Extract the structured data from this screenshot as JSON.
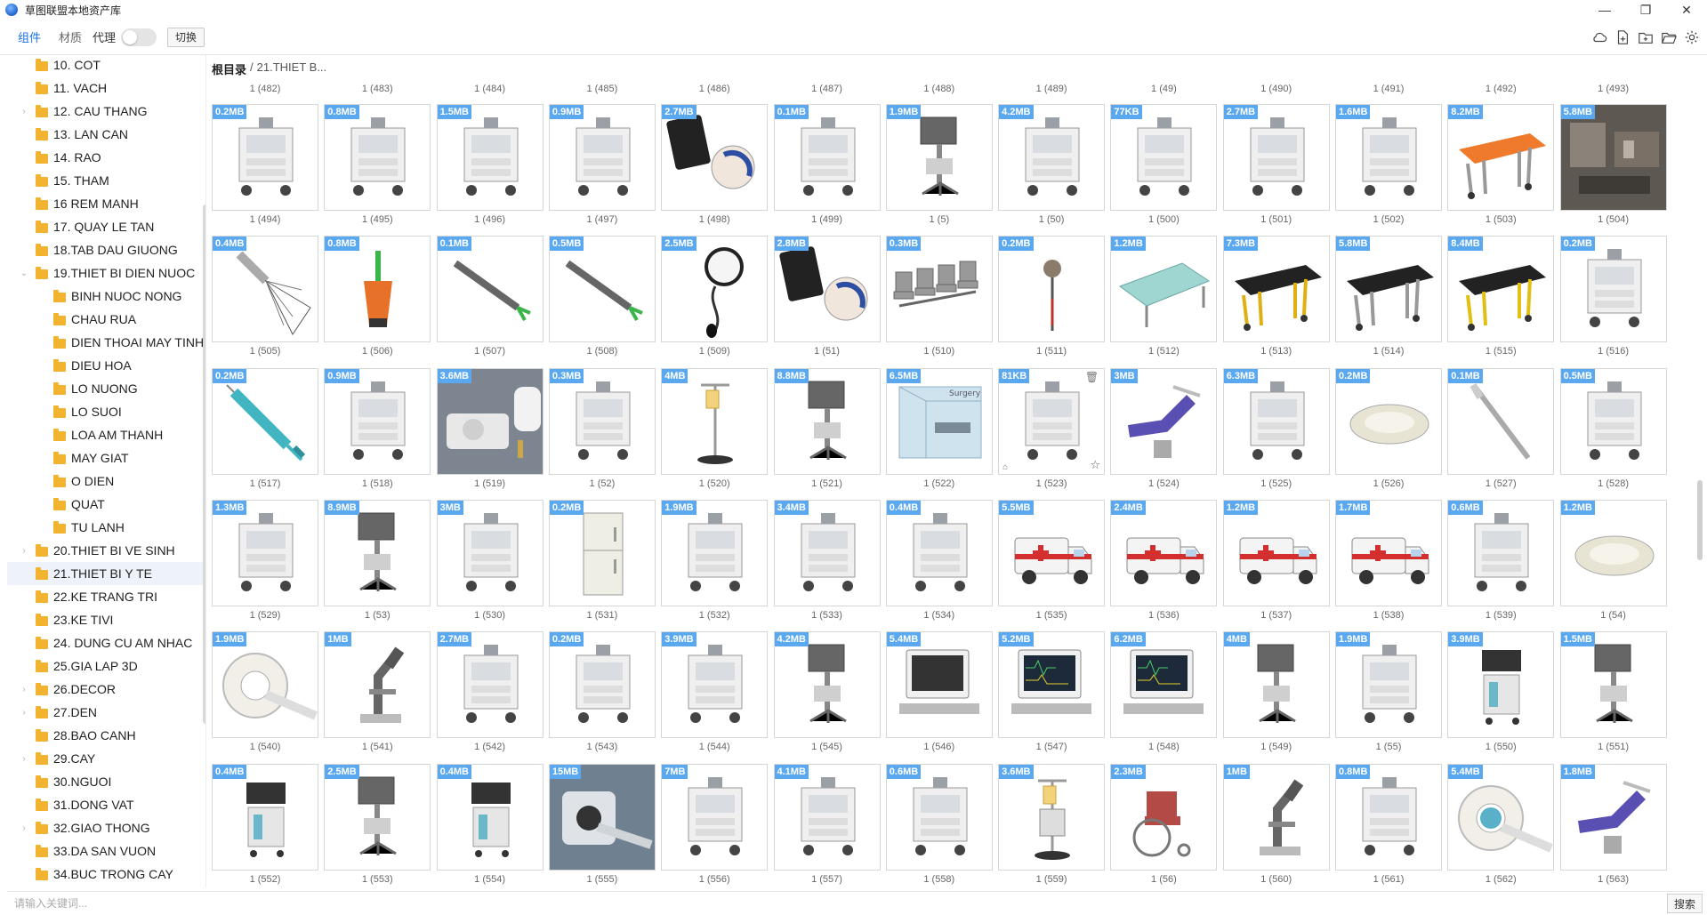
{
  "window": {
    "title": "草图联盟本地资产库",
    "minimize": "—",
    "maximize": "❐",
    "close": "✕"
  },
  "toolbar": {
    "tabs": [
      "组件",
      "材质"
    ],
    "proxy_label": "代理",
    "switch_label": "切换",
    "icons": [
      "cloud-icon",
      "file-add-icon",
      "folder-add-icon",
      "folder-open-icon",
      "gear-icon"
    ]
  },
  "sidebar": {
    "items": [
      {
        "label": "10. COT",
        "level": 0,
        "expandable": false
      },
      {
        "label": "11. VACH",
        "level": 0,
        "expandable": false
      },
      {
        "label": "12. CAU THANG",
        "level": 0,
        "expandable": true
      },
      {
        "label": "13. LAN CAN",
        "level": 0,
        "expandable": false
      },
      {
        "label": "14. RAO",
        "level": 0,
        "expandable": false
      },
      {
        "label": "15. THAM",
        "level": 0,
        "expandable": false
      },
      {
        "label": "16 REM MANH",
        "level": 0,
        "expandable": false
      },
      {
        "label": "17. QUAY LE TAN",
        "level": 0,
        "expandable": false
      },
      {
        "label": "18.TAB DAU GIUONG",
        "level": 0,
        "expandable": false
      },
      {
        "label": "19.THIET BI DIEN NUOC",
        "level": 0,
        "expandable": true,
        "expanded": true
      },
      {
        "label": "BINH NUOC NONG",
        "level": 1,
        "expandable": false
      },
      {
        "label": "CHAU RUA",
        "level": 1,
        "expandable": false
      },
      {
        "label": "DIEN THOAI MAY TINH",
        "level": 1,
        "expandable": false
      },
      {
        "label": "DIEU HOA",
        "level": 1,
        "expandable": false
      },
      {
        "label": "LO NUONG",
        "level": 1,
        "expandable": false
      },
      {
        "label": "LO SUOI",
        "level": 1,
        "expandable": false
      },
      {
        "label": "LOA AM THANH",
        "level": 1,
        "expandable": false
      },
      {
        "label": "MAY GIAT",
        "level": 1,
        "expandable": false
      },
      {
        "label": "O DIEN",
        "level": 1,
        "expandable": false
      },
      {
        "label": "QUAT",
        "level": 1,
        "expandable": false
      },
      {
        "label": "TU LANH",
        "level": 1,
        "expandable": false
      },
      {
        "label": "20.THIET BI VE SINH",
        "level": 0,
        "expandable": true
      },
      {
        "label": "21.THIET BI Y TE",
        "level": 0,
        "expandable": false,
        "selected": true
      },
      {
        "label": "22.KE TRANG TRI",
        "level": 0,
        "expandable": false
      },
      {
        "label": "23.KE TIVI",
        "level": 0,
        "expandable": false
      },
      {
        "label": "24. DUNG CU AM NHAC",
        "level": 0,
        "expandable": false
      },
      {
        "label": "25.GIA LAP 3D",
        "level": 0,
        "expandable": false
      },
      {
        "label": "26.DECOR",
        "level": 0,
        "expandable": true
      },
      {
        "label": "27.DEN",
        "level": 0,
        "expandable": true
      },
      {
        "label": "28.BAO CANH",
        "level": 0,
        "expandable": false
      },
      {
        "label": "29.CAY",
        "level": 0,
        "expandable": true
      },
      {
        "label": "30.NGUOI",
        "level": 0,
        "expandable": false
      },
      {
        "label": "31.DONG VAT",
        "level": 0,
        "expandable": false
      },
      {
        "label": "32.GIAO THONG",
        "level": 0,
        "expandable": true
      },
      {
        "label": "33.DA SAN VUON",
        "level": 0,
        "expandable": false
      },
      {
        "label": "34.BUC TRONG CAY",
        "level": 0,
        "expandable": false
      }
    ]
  },
  "breadcrumb": {
    "root": "根目录",
    "separator": "/",
    "current": "21.THIET B..."
  },
  "top_labels": [
    "1 (482)",
    "1 (483)",
    "1 (484)",
    "1 (485)",
    "1 (486)",
    "1 (487)",
    "1 (488)",
    "1 (489)",
    "1 (49)",
    "1 (490)",
    "1 (491)",
    "1 (492)",
    "1 (493)"
  ],
  "rows": [
    {
      "sizes": [
        "0.2MB",
        "0.8MB",
        "1.5MB",
        "0.9MB",
        "2.7MB",
        "0.1MB",
        "1.9MB",
        "4.2MB",
        "77KB",
        "2.7MB",
        "1.6MB",
        "8.2MB",
        "5.8MB"
      ],
      "labels": [
        "1 (494)",
        "1 (495)",
        "1 (496)",
        "1 (497)",
        "1 (498)",
        "1 (499)",
        "1 (5)",
        "1 (50)",
        "1 (500)",
        "1 (501)",
        "1 (502)",
        "1 (503)",
        "1 (504)"
      ],
      "icons": [
        "medical-cart-icon",
        "lab-cabinet-icon",
        "server-rack-icon",
        "xray-machine-icon",
        "tablet-scanner-icon",
        "instrument-table-icon",
        "monitor-cart-icon",
        "laser-unit-icon",
        "surgical-table-icon",
        "wall-arm-icon",
        "ceiling-lamp-icon",
        "stretcher-icon",
        "clinic-room-icon"
      ]
    },
    {
      "sizes": [
        "0.4MB",
        "0.8MB",
        "0.1MB",
        "0.5MB",
        "2.5MB",
        "2.8MB",
        "0.3MB",
        "0.2MB",
        "1.2MB",
        "7.3MB",
        "5.8MB",
        "8.4MB",
        "0.2MB"
      ],
      "labels": [
        "1 (505)",
        "1 (506)",
        "1 (507)",
        "1 (508)",
        "1 (509)",
        "1 (51)",
        "1 (510)",
        "1 (511)",
        "1 (512)",
        "1 (513)",
        "1 (514)",
        "1 (515)",
        "1 (516)"
      ],
      "icons": [
        "exam-lamp-icon",
        "oxygen-flask-icon",
        "probe-icon",
        "forceps-icon",
        "bp-gauge-icon",
        "tablet-scanner-icon",
        "waiting-chairs-icon",
        "thermometer-icon",
        "bed-mattress-icon",
        "stretcher-yellow-icon",
        "stretcher-black-icon",
        "stretcher-green-icon",
        "suction-cart-icon"
      ]
    },
    {
      "sizes": [
        "0.2MB",
        "0.9MB",
        "3.6MB",
        "0.3MB",
        "4MB",
        "8.8MB",
        "6.5MB",
        "81KB",
        "3MB",
        "6.3MB",
        "0.2MB",
        "0.1MB",
        "0.5MB"
      ],
      "labels": [
        "1 (517)",
        "1 (518)",
        "1 (519)",
        "1 (52)",
        "1 (520)",
        "1 (521)",
        "1 (522)",
        "1 (523)",
        "1 (524)",
        "1 (525)",
        "1 (526)",
        "1 (527)",
        "1 (528)"
      ],
      "icons": [
        "syringe-icon",
        "tray-icon",
        "bp-monitor-icon",
        "suction-cart-icon",
        "iv-stand-icon",
        "monitor-stand-icon",
        "operating-room-icon",
        "device-panel-icon",
        "dental-chair-icon",
        "wall-console-icon",
        "pillow-icon",
        "scalpel-icon",
        "drawer-cart-icon"
      ]
    },
    {
      "sizes": [
        "1.3MB",
        "8.9MB",
        "3MB",
        "0.2MB",
        "1.9MB",
        "3.4MB",
        "0.4MB",
        "5.5MB",
        "2.4MB",
        "1.2MB",
        "1.7MB",
        "0.6MB",
        "1.2MB"
      ],
      "labels": [
        "1 (529)",
        "1 (53)",
        "1 (530)",
        "1 (531)",
        "1 (532)",
        "1 (533)",
        "1 (534)",
        "1 (535)",
        "1 (536)",
        "1 (537)",
        "1 (538)",
        "1 (539)",
        "1 (54)"
      ],
      "icons": [
        "pressure-regulator-icon",
        "monitor-stand-icon",
        "wall-hook-icon",
        "refrigerator-icon",
        "xray-table-icon",
        "surgical-light-icon",
        "resuscitator-icon",
        "ambulance-icon",
        "ambulance-icon",
        "ambulance-icon",
        "ambulance-icon",
        "steel-cart-icon",
        "sink-icon"
      ]
    },
    {
      "sizes": [
        "1.9MB",
        "1MB",
        "2.7MB",
        "0.2MB",
        "3.9MB",
        "4.2MB",
        "5.4MB",
        "5.2MB",
        "6.2MB",
        "4MB",
        "1.9MB",
        "3.9MB",
        "1.5MB"
      ],
      "labels": [
        "1 (540)",
        "1 (541)",
        "1 (542)",
        "1 (543)",
        "1 (544)",
        "1 (545)",
        "1 (546)",
        "1 (547)",
        "1 (548)",
        "1 (549)",
        "1 (55)",
        "1 (550)",
        "1 (551)"
      ],
      "icons": [
        "ct-scanner-icon",
        "microscope-icon",
        "incubator-icon",
        "scale-icon",
        "control-desk-icon",
        "computer-cart-icon",
        "computer-icon",
        "patient-monitor-icon",
        "vital-monitor-icon",
        "workstation-icon",
        "exam-table-icon",
        "anesthesia-icon",
        "monitor-stand-icon"
      ]
    },
    {
      "sizes": [
        "0.4MB",
        "2.5MB",
        "0.4MB",
        "15MB",
        "7MB",
        "4.1MB",
        "0.6MB",
        "3.6MB",
        "2.3MB",
        "1MB",
        "0.8MB",
        "5.4MB",
        "1.8MB"
      ],
      "labels": [
        "1 (552)",
        "1 (553)",
        "1 (554)",
        "1 (555)",
        "1 (556)",
        "1 (557)",
        "1 (558)",
        "1 (559)",
        "1 (56)",
        "1 (560)",
        "1 (561)",
        "1 (562)",
        "1 (563)"
      ],
      "icons": [
        "ultrasound-icon",
        "workstation-icon",
        "ventilator-icon",
        "mri-room-icon",
        "recliner-icon",
        "medicine-cart-icon",
        "glass-cabinet-icon",
        "iv-pump-icon",
        "wheelchair-icon",
        "microscope-icon",
        "ceiling-arm-icon",
        "mri-icon",
        "dental-unit-icon"
      ]
    }
  ],
  "search": {
    "placeholder": "请输入关键词...",
    "button": "搜索"
  }
}
